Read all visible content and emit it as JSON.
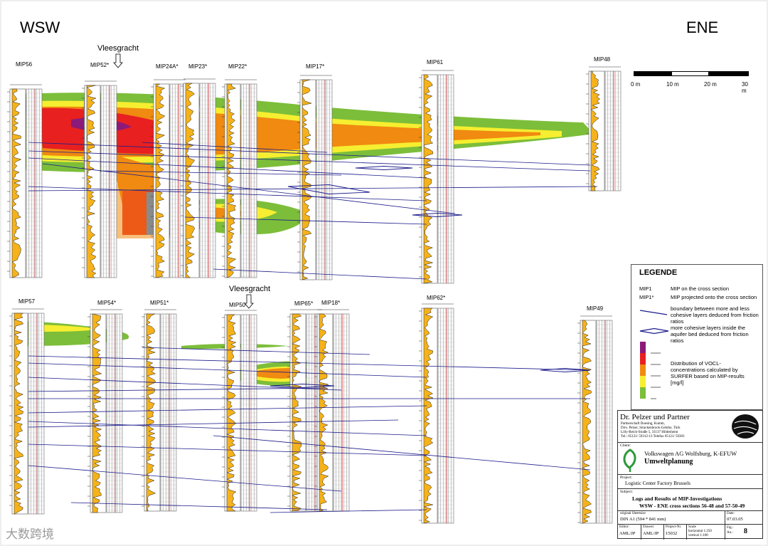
{
  "top_section": {
    "direction_left": "WSW",
    "direction_right": "ENE",
    "landmark": "Vleesgracht",
    "wells": [
      "MIP56",
      "MIP52*",
      "MIP24A*",
      "MIP23*",
      "MIP22*",
      "MIP17*",
      "MIP61",
      "MIP48"
    ]
  },
  "bottom_section": {
    "landmark": "Vleesgracht",
    "wells": [
      "MIP57",
      "MIP54*",
      "MIP51*",
      "MIP50",
      "MIP65*",
      "MIP18*",
      "MIP62*",
      "MIP49"
    ]
  },
  "scale_bar": {
    "labels": [
      "0 m",
      "10 m",
      "20 m",
      "30 m"
    ]
  },
  "legend": {
    "title": "LEGENDE",
    "mip_code": "MIP1",
    "mip_desc": "MIP on the cross section",
    "mip_proj_code": "MIP1*",
    "mip_proj_desc": "MIP projected onto the cross section",
    "boundary_desc": "boundary between more and less cohesive layers deduced from friction ratios",
    "cohesive_desc": "more cohesive layers inside the aquifer bed deduced from friction ratios",
    "distribution_desc": "Distribution of VOCL-concentrations calculated by SURFER based on MIP-results [mg/l]",
    "colors": [
      "#8b1a7a",
      "#e82020",
      "#f08a10",
      "#f6ee30",
      "#7cbe3a"
    ]
  },
  "colors": {
    "purple": "#8b1a7a",
    "red": "#e82020",
    "orange": "#f08a10",
    "yellow": "#f6ee30",
    "green": "#7cbe3a",
    "logyellow": "#f5b21a",
    "gray": "#8a8a8a",
    "line": "#1c1c8c"
  },
  "title_block": {
    "firm": "Dr. Pelzer und Partner",
    "firm_line1": "Partnerschaft Duesing, Kumm,",
    "firm_line2": "Drrs. Pelzer, Strackenbrock-Gehrke, Türk",
    "firm_line3": "Lilly-Reich-Straße 5, 31137 Hildesheim",
    "firm_line4": "Tel.: 05121/ 59312-13  Telefax 05121/ 59303",
    "client_label": "Client:",
    "client": "Volkswagen AG Wolfsburg, K-EFUW",
    "client_dept": "Umweltplanung",
    "project_label": "Project:",
    "project": "Logistic Center Factory Brussels",
    "subject_label": "Subject:",
    "subject_line1": "Logs and Results of MIP-Investigations",
    "subject_line2": "WSW - ENE cross sections 56-48 and 57-50-49",
    "sheet_label": "original Sheetsize",
    "sheet_size": "DIN A1 (594 * 841 mm)",
    "date_label": "Date:",
    "date": "07.03.05",
    "editor_label": "Editor:",
    "editor": "AML/JP",
    "drawer_label": "Drawer:",
    "drawer": "AML/JP",
    "projnr_label": "Project-Nr.",
    "projnr": "15032",
    "scale_label": "Scale",
    "scale_h": "horizontal 1:250",
    "scale_v": "vertical 1:100",
    "fig_label": "Fig.:",
    "fig_label2": "An.:",
    "fig": "8"
  },
  "watermark": "大数跨境"
}
